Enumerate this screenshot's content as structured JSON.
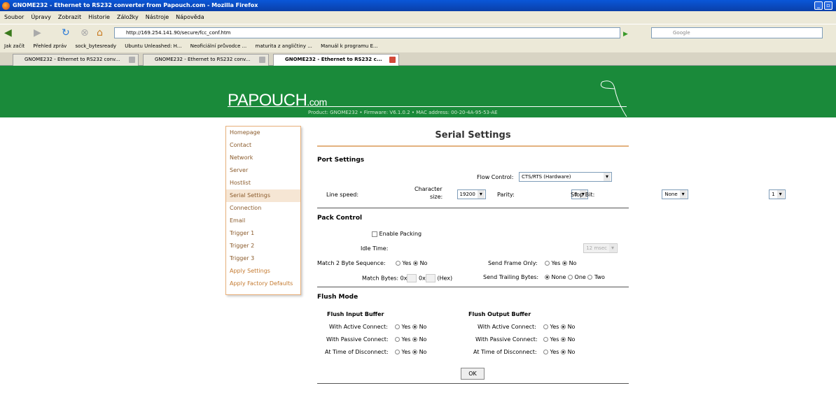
{
  "window": {
    "title": "GNOME232 - Ethernet to RS232 converter from Papouch.com - Mozilla Firefox"
  },
  "menu": [
    "Soubor",
    "Úpravy",
    "Zobrazit",
    "Historie",
    "Záložky",
    "Nástroje",
    "Nápověda"
  ],
  "url": "http://169.254.141.90/secure/fcc_conf.htm",
  "search_placeholder": "Google",
  "bookmarks": [
    "Jak začít",
    "Přehled zpráv",
    "sock_bytesready",
    "Ubuntu Unleashed: H...",
    "Neoficiální průvodce ...",
    "maturita z angličtiny ...",
    "Manuál k programu E..."
  ],
  "tabs": [
    "GNOME232 - Ethernet to RS232 conv...",
    "GNOME232 - Ethernet to RS232 conv...",
    "GNOME232 - Ethernet to RS232 c..."
  ],
  "logo": {
    "main": "PAPOUCH",
    "suffix": ".com"
  },
  "product": "Product: GNOME232 • Firmware: V6.1.0.2 • MAC address: 00-20-4A-95-53-AE",
  "sidebar": [
    "Homepage",
    "Contact",
    "Network",
    "Server",
    "Hostlist",
    "Serial Settings",
    "Connection",
    "Email",
    "Trigger 1",
    "Trigger 2",
    "Trigger 3",
    "Apply Settings",
    "Apply Factory Defaults"
  ],
  "page_title": "Serial Settings",
  "port": {
    "title": "Port Settings",
    "flow_label": "Flow Control:",
    "flow_value": "CTS/RTS (Hardware)",
    "speed_label": "Line speed:",
    "speed_value": "19200",
    "char_label1": "Character",
    "char_label2": "size:",
    "char_value": "8",
    "parity_label": "Parity:",
    "parity_value": "None",
    "stop_label": "Stop Bit:",
    "stop_value": "1"
  },
  "pack": {
    "title": "Pack Control",
    "enable_label": "Enable Packing",
    "idle_label": "Idle Time:",
    "idle_value": "12 msec",
    "match_seq_label": "Match 2 Byte Sequence:",
    "yes": "Yes",
    "no": "No",
    "send_frame_label": "Send Frame Only:",
    "match_bytes_label": "Match Bytes: 0x",
    "hex_sep": "0x",
    "hex_suffix": "(Hex)",
    "trailing_label": "Send Trailing Bytes:",
    "none": "None",
    "one": "One",
    "two": "Two"
  },
  "flush": {
    "title": "Flush Mode",
    "input_title": "Flush Input Buffer",
    "output_title": "Flush Output Buffer",
    "active": "With Active Connect:",
    "passive": "With Passive Connect:",
    "disconnect": "At Time of Disconnect:"
  },
  "ok": "OK"
}
